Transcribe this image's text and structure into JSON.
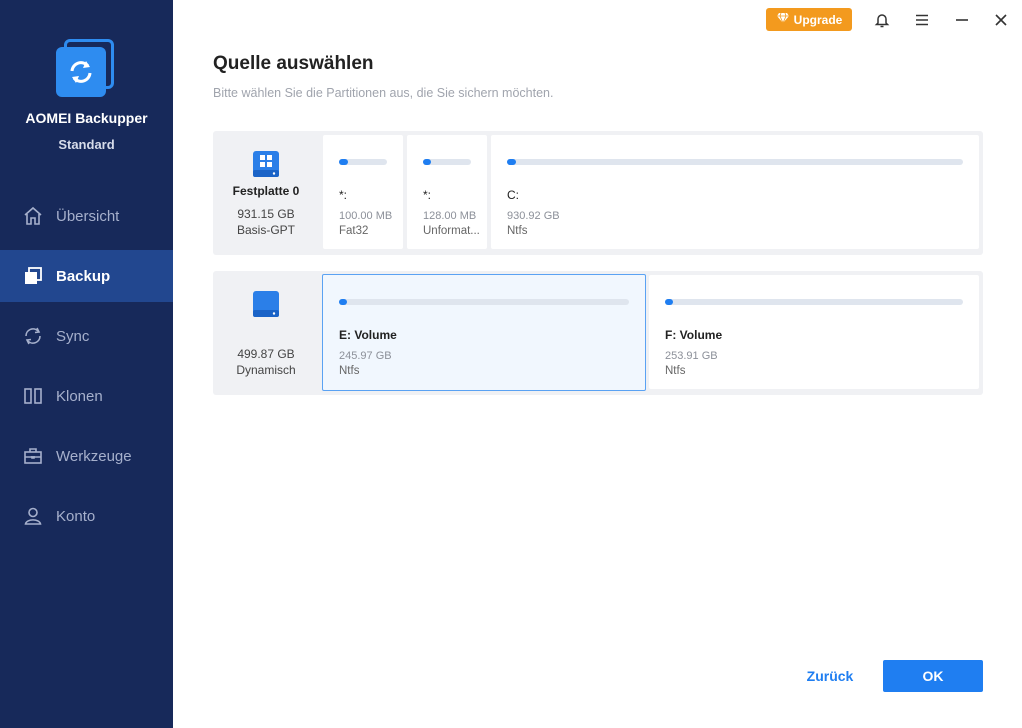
{
  "app": {
    "name": "AOMEI Backupper",
    "edition": "Standard"
  },
  "nav": [
    {
      "label": "Übersicht",
      "icon": "home-icon",
      "active": false
    },
    {
      "label": "Backup",
      "icon": "backup-icon",
      "active": true
    },
    {
      "label": "Sync",
      "icon": "sync-icon",
      "active": false
    },
    {
      "label": "Klonen",
      "icon": "clone-icon",
      "active": false
    },
    {
      "label": "Werkzeuge",
      "icon": "toolbox-icon",
      "active": false
    },
    {
      "label": "Konto",
      "icon": "user-icon",
      "active": false
    }
  ],
  "titlebar": {
    "upgrade_label": "Upgrade"
  },
  "main": {
    "title": "Quelle auswählen",
    "subtitle": "Bitte wählen Sie die Partitionen aus, die Sie sichern möchten."
  },
  "disks": [
    {
      "name": "Festplatte 0",
      "size": "931.15 GB",
      "type": "Basis-GPT",
      "partitions": [
        {
          "name": "*:",
          "size": "100.00 MB",
          "fs": "Fat32",
          "used_fraction": 0.18
        },
        {
          "name": "*:",
          "size": "128.00 MB",
          "fs": "Unformat...",
          "used_fraction": 0.05
        },
        {
          "name": "C:",
          "size": "930.92 GB",
          "fs": "Ntfs",
          "used_fraction": 0.02
        }
      ]
    },
    {
      "name": "",
      "size": "499.87 GB",
      "type": "Dynamisch",
      "partitions": [
        {
          "name": "E: Volume",
          "size": "245.97 GB",
          "fs": "Ntfs",
          "used_fraction": 0.01,
          "selected": true
        },
        {
          "name": "F: Volume",
          "size": "253.91 GB",
          "fs": "Ntfs",
          "used_fraction": 0.01
        }
      ]
    }
  ],
  "footer": {
    "back_label": "Zurück",
    "ok_label": "OK"
  },
  "colors": {
    "sidebar": "#17295a",
    "sidebar_active": "#22478f",
    "accent": "#1f7ef1",
    "upgrade": "#f39a1e"
  }
}
